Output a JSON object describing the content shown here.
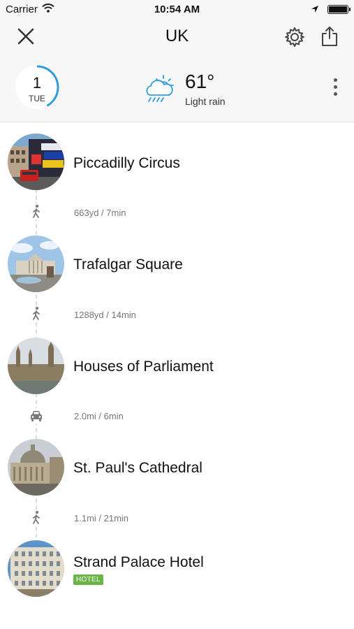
{
  "status_bar": {
    "carrier": "Carrier",
    "time": "10:54 AM"
  },
  "nav": {
    "title": "UK"
  },
  "day": {
    "number": "1",
    "weekday": "TUE",
    "progress": 0.42
  },
  "weather": {
    "temperature": "61°",
    "condition": "Light rain",
    "icon": "cloud-rain-sun-icon"
  },
  "stops": [
    {
      "name": "Piccadilly Circus"
    },
    {
      "name": "Trafalgar Square"
    },
    {
      "name": "Houses of Parliament"
    },
    {
      "name": "St. Paul's Cathedral"
    },
    {
      "name": "Strand Palace Hotel",
      "tag": "HOTEL"
    }
  ],
  "legs": [
    {
      "mode": "walk",
      "text": "663yd / 7min"
    },
    {
      "mode": "walk",
      "text": "1288yd / 14min"
    },
    {
      "mode": "car",
      "text": "2.0mi / 6min"
    },
    {
      "mode": "walk",
      "text": "1.1mi / 21min"
    }
  ],
  "colors": {
    "accent": "#2f9be0",
    "hotel_tag": "#6ab548"
  }
}
